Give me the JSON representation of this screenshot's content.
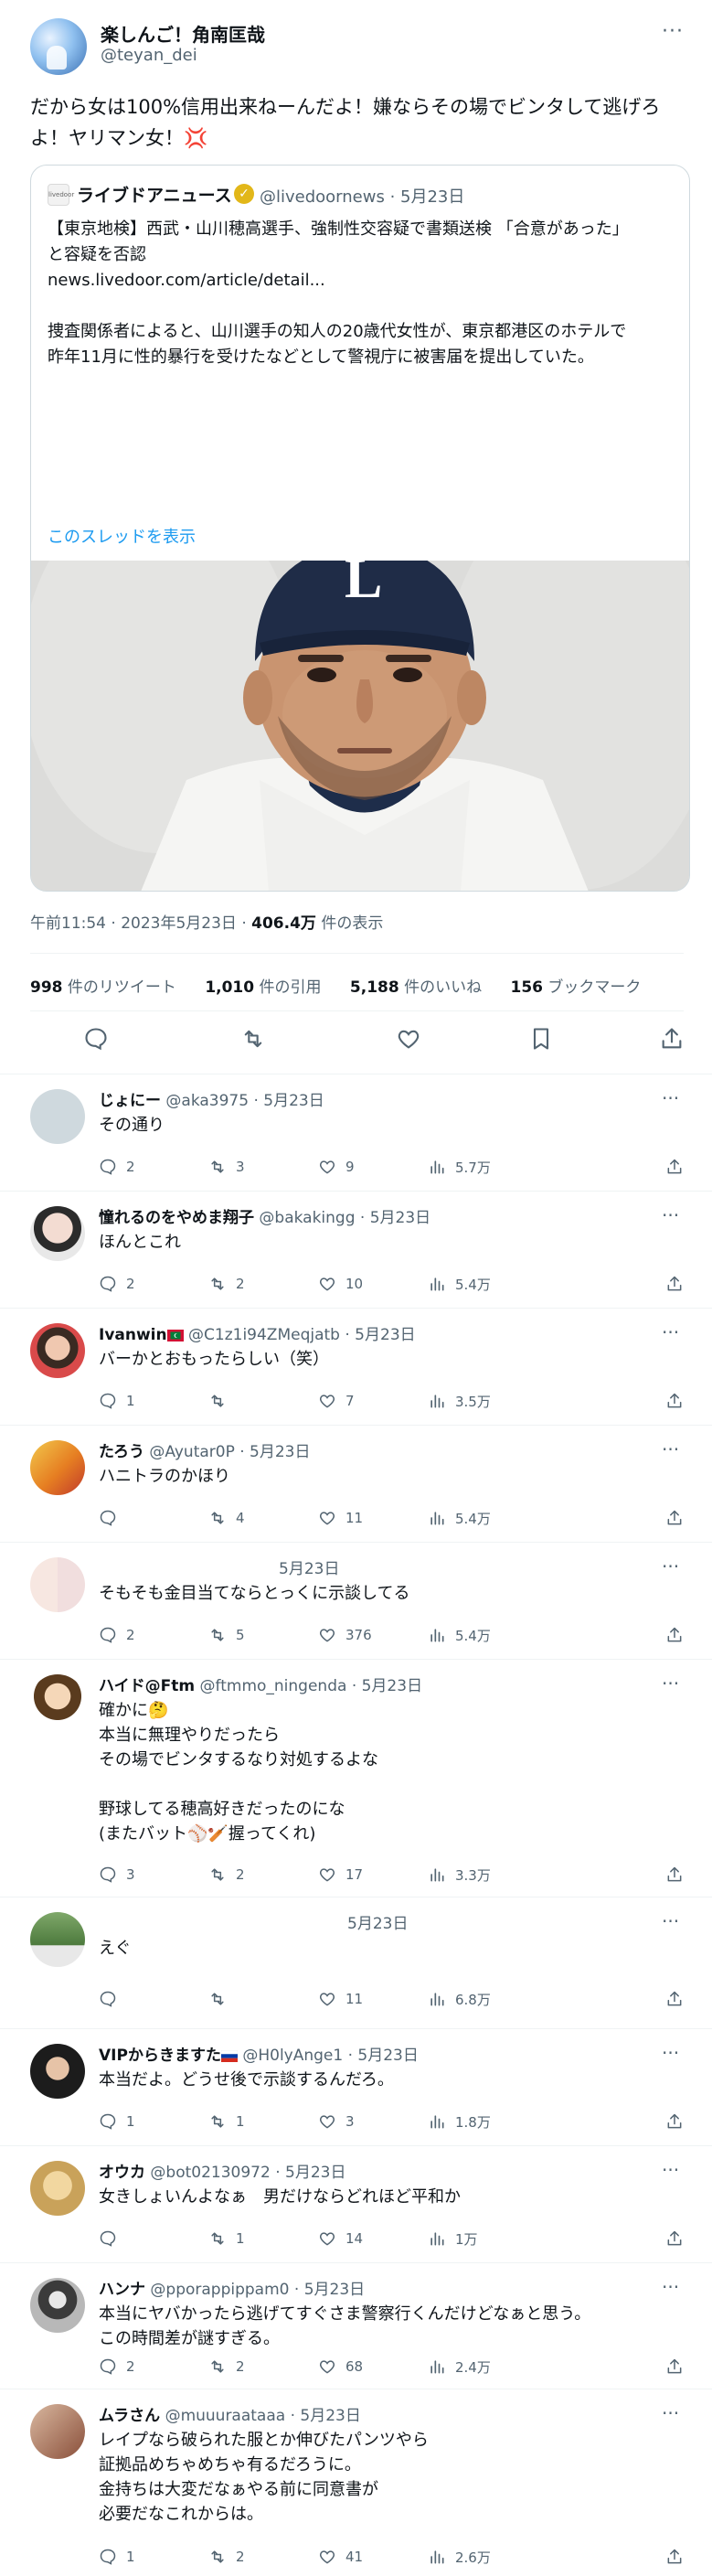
{
  "main_tweet": {
    "author_name": "楽しんご！角南匡哉",
    "author_handle": "@teyan_dei",
    "text_line1": "だから女は100%信用出来ねーんだよ！嫌ならその場でビンタして逃げろ",
    "text_line2": "よ！ヤリマン女！",
    "text_emoji": "💢",
    "quote": {
      "logo_text": "livedoor",
      "author_name": "ライブドアニュース",
      "author_handle": "@livedoornews · 5月23日",
      "body_line1": "【東京地検】西武・山川穂高選手、強制性交容疑で書類送検 「合意があった」",
      "body_line2": "と容疑を否認",
      "body_line3": "news.livedoor.com/article/detail...",
      "body_line4": "捜査関係者によると、山川選手の知人の20歳代女性が、東京都港区のホテルで",
      "body_line5": "昨年11月に性的暴行を受けたなどとして警視庁に被害届を提出していた。",
      "show_thread": "このスレッドを表示",
      "cap_letter": "L"
    },
    "meta_time": "午前11:54 · 2023年5月23日 · ",
    "meta_views": "406.4万",
    "meta_views_suffix": " 件の表示",
    "retweets_count": "998",
    "retweets_label": " 件のリツイート",
    "quotes_count": "1,010",
    "quotes_label": " 件の引用",
    "likes_count": "5,188",
    "likes_label": " 件のいいね",
    "bookmarks_count": "156",
    "bookmarks_label": " ブックマーク"
  },
  "more_icon": "···",
  "replies": [
    {
      "name": "じょにー",
      "handle": "@aka3975 · 5月23日",
      "text": [
        "その通り"
      ],
      "reply": "2",
      "retweet": "3",
      "like": "9",
      "views": "5.7万"
    },
    {
      "name": "憧れるのをやめま翔子",
      "handle": "@bakakingg · 5月23日",
      "text": [
        "ほんとこれ"
      ],
      "reply": "2",
      "retweet": "2",
      "like": "10",
      "views": "5.4万"
    },
    {
      "name": "Ivanwin",
      "handle": "@C1z1i94ZMeqjatb · 5月23日",
      "text": [
        "バーかとおもったらしい（笑）"
      ],
      "reply": "1",
      "retweet": "",
      "like": "7",
      "views": "3.5万"
    },
    {
      "name": "たろう",
      "handle": "@Ayutar0P · 5月23日",
      "text": [
        "ハニトラのかほり"
      ],
      "reply": "",
      "retweet": "4",
      "like": "11",
      "views": "5.4万"
    },
    {
      "name": "",
      "handle": "5月23日",
      "text": [
        "そもそも金目当てならとっくに示談してる"
      ],
      "reply": "2",
      "retweet": "5",
      "like": "376",
      "views": "5.4万"
    },
    {
      "name": "ハイド@Ftm",
      "handle": "@ftmmo_ningenda · 5月23日",
      "text": [
        "確かに🤔",
        "本当に無理やりだったら",
        "その場でビンタするなり対処するよな",
        "",
        "野球してる穂高好きだったのにな",
        "(またバット⚾🏏握ってくれ)"
      ],
      "reply": "3",
      "retweet": "2",
      "like": "17",
      "views": "3.3万"
    },
    {
      "name": "",
      "handle": "5月23日",
      "text": [
        "えぐ"
      ],
      "reply": "",
      "retweet": "",
      "like": "11",
      "views": "6.8万"
    },
    {
      "name": "VIPからきますた",
      "handle": "@H0lyAnge1 · 5月23日",
      "text": [
        "本当だよ。どうせ後で示談するんだろ。"
      ],
      "reply": "1",
      "retweet": "1",
      "like": "3",
      "views": "1.8万"
    },
    {
      "name": "オウカ",
      "handle": "@bot02130972 · 5月23日",
      "text": [
        "女きしょいんよなぁ　男だけならどれほど平和か"
      ],
      "reply": "",
      "retweet": "1",
      "like": "14",
      "views": "1万"
    },
    {
      "name": "ハンナ",
      "handle": "@pporappippam0 · 5月23日",
      "text": [
        "本当にヤバかったら逃げてすぐさま警察行くんだけどなぁと思う。",
        "この時間差が謎すぎる。"
      ],
      "reply": "2",
      "retweet": "2",
      "like": "68",
      "views": "2.4万"
    },
    {
      "name": "ムラさん",
      "handle": "@muuuraataaa · 5月23日",
      "text": [
        "レイプなら破られた服とか伸びたパンツやら",
        "証拠品めちゃめちゃ有るだろうに。",
        "金持ちは大変だなぁやる前に同意書が",
        "必要だなこれからは。"
      ],
      "reply": "1",
      "retweet": "2",
      "like": "41",
      "views": "2.6万"
    }
  ],
  "colors": {
    "text": "#0f1419",
    "muted": "#536471",
    "link": "#1d9bf0",
    "border": "#cfd9de"
  }
}
